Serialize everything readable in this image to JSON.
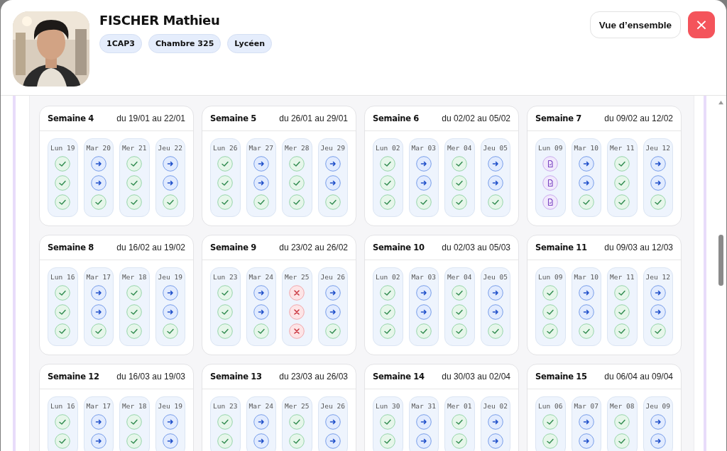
{
  "student": {
    "name": "FISCHER Mathieu",
    "tags": [
      "1CAP3",
      "Chambre 325",
      "Lycéen"
    ]
  },
  "buttons": {
    "overview": "Vue d’ensemble",
    "close": "×"
  },
  "weeks": [
    {
      "title": "Semaine 4",
      "range": "du 19/01 au 22/01",
      "days": [
        {
          "label": "Lun 19",
          "marks": [
            {
              "kind": "present"
            },
            {
              "kind": "present"
            },
            {
              "kind": "present"
            }
          ]
        },
        {
          "label": "Mar 20",
          "marks": [
            {
              "kind": "transfer"
            },
            {
              "kind": "transfer"
            },
            {
              "kind": "present"
            }
          ]
        },
        {
          "label": "Mer 21",
          "marks": [
            {
              "kind": "present"
            },
            {
              "kind": "present"
            },
            {
              "kind": "present"
            }
          ]
        },
        {
          "label": "Jeu 22",
          "marks": [
            {
              "kind": "transfer"
            },
            {
              "kind": "transfer"
            },
            {
              "kind": "present"
            }
          ]
        }
      ]
    },
    {
      "title": "Semaine 5",
      "range": "du 26/01 au 29/01",
      "days": [
        {
          "label": "Lun 26",
          "marks": [
            {
              "kind": "present"
            },
            {
              "kind": "present"
            },
            {
              "kind": "present"
            }
          ]
        },
        {
          "label": "Mar 27",
          "marks": [
            {
              "kind": "transfer"
            },
            {
              "kind": "transfer"
            },
            {
              "kind": "present"
            }
          ]
        },
        {
          "label": "Mer 28",
          "marks": [
            {
              "kind": "present"
            },
            {
              "kind": "present"
            },
            {
              "kind": "present"
            }
          ]
        },
        {
          "label": "Jeu 29",
          "marks": [
            {
              "kind": "transfer"
            },
            {
              "kind": "transfer"
            },
            {
              "kind": "present"
            }
          ]
        }
      ]
    },
    {
      "title": "Semaine 6",
      "range": "du 02/02 au 05/02",
      "days": [
        {
          "label": "Lun 02",
          "marks": [
            {
              "kind": "present"
            },
            {
              "kind": "present"
            },
            {
              "kind": "present"
            }
          ]
        },
        {
          "label": "Mar 03",
          "marks": [
            {
              "kind": "transfer"
            },
            {
              "kind": "transfer"
            },
            {
              "kind": "present"
            }
          ]
        },
        {
          "label": "Mer 04",
          "marks": [
            {
              "kind": "present"
            },
            {
              "kind": "present"
            },
            {
              "kind": "present"
            }
          ]
        },
        {
          "label": "Jeu 05",
          "marks": [
            {
              "kind": "transfer"
            },
            {
              "kind": "transfer"
            },
            {
              "kind": "present"
            }
          ]
        }
      ]
    },
    {
      "title": "Semaine 7",
      "range": "du 09/02 au 12/02",
      "days": [
        {
          "label": "Lun 09",
          "marks": [
            {
              "kind": "document"
            },
            {
              "kind": "document"
            },
            {
              "kind": "document"
            }
          ]
        },
        {
          "label": "Mar 10",
          "marks": [
            {
              "kind": "transfer"
            },
            {
              "kind": "transfer"
            },
            {
              "kind": "present"
            }
          ]
        },
        {
          "label": "Mer 11",
          "marks": [
            {
              "kind": "present"
            },
            {
              "kind": "present"
            },
            {
              "kind": "present"
            }
          ]
        },
        {
          "label": "Jeu 12",
          "marks": [
            {
              "kind": "transfer"
            },
            {
              "kind": "transfer"
            },
            {
              "kind": "present"
            }
          ]
        }
      ]
    },
    {
      "title": "Semaine 8",
      "range": "du 16/02 au 19/02",
      "days": [
        {
          "label": "Lun 16",
          "marks": [
            {
              "kind": "present"
            },
            {
              "kind": "present"
            },
            {
              "kind": "present"
            }
          ]
        },
        {
          "label": "Mar 17",
          "marks": [
            {
              "kind": "transfer"
            },
            {
              "kind": "transfer"
            },
            {
              "kind": "present"
            }
          ]
        },
        {
          "label": "Mer 18",
          "marks": [
            {
              "kind": "present"
            },
            {
              "kind": "present"
            },
            {
              "kind": "present"
            }
          ]
        },
        {
          "label": "Jeu 19",
          "marks": [
            {
              "kind": "transfer"
            },
            {
              "kind": "transfer"
            },
            {
              "kind": "present"
            }
          ]
        }
      ]
    },
    {
      "title": "Semaine 9",
      "range": "du 23/02 au 26/02",
      "days": [
        {
          "label": "Lun 23",
          "marks": [
            {
              "kind": "present"
            },
            {
              "kind": "present"
            },
            {
              "kind": "present"
            }
          ]
        },
        {
          "label": "Mar 24",
          "marks": [
            {
              "kind": "transfer"
            },
            {
              "kind": "transfer"
            },
            {
              "kind": "present"
            }
          ]
        },
        {
          "label": "Mer 25",
          "marks": [
            {
              "kind": "absent"
            },
            {
              "kind": "absent"
            },
            {
              "kind": "absent"
            }
          ]
        },
        {
          "label": "Jeu 26",
          "marks": [
            {
              "kind": "transfer"
            },
            {
              "kind": "transfer"
            },
            {
              "kind": "present"
            }
          ]
        }
      ]
    },
    {
      "title": "Semaine 10",
      "range": "du 02/03 au 05/03",
      "days": [
        {
          "label": "Lun 02",
          "marks": [
            {
              "kind": "present"
            },
            {
              "kind": "present"
            },
            {
              "kind": "present"
            }
          ]
        },
        {
          "label": "Mar 03",
          "marks": [
            {
              "kind": "transfer"
            },
            {
              "kind": "transfer"
            },
            {
              "kind": "present"
            }
          ]
        },
        {
          "label": "Mer 04",
          "marks": [
            {
              "kind": "present"
            },
            {
              "kind": "present"
            },
            {
              "kind": "present"
            }
          ]
        },
        {
          "label": "Jeu 05",
          "marks": [
            {
              "kind": "transfer"
            },
            {
              "kind": "transfer"
            },
            {
              "kind": "present"
            }
          ]
        }
      ]
    },
    {
      "title": "Semaine 11",
      "range": "du 09/03 au 12/03",
      "days": [
        {
          "label": "Lun 09",
          "marks": [
            {
              "kind": "present"
            },
            {
              "kind": "present"
            },
            {
              "kind": "present"
            }
          ]
        },
        {
          "label": "Mar 10",
          "marks": [
            {
              "kind": "transfer"
            },
            {
              "kind": "transfer"
            },
            {
              "kind": "present"
            }
          ]
        },
        {
          "label": "Mer 11",
          "marks": [
            {
              "kind": "present"
            },
            {
              "kind": "present"
            },
            {
              "kind": "present"
            }
          ]
        },
        {
          "label": "Jeu 12",
          "marks": [
            {
              "kind": "transfer"
            },
            {
              "kind": "transfer"
            },
            {
              "kind": "present"
            }
          ]
        }
      ]
    },
    {
      "title": "Semaine 12",
      "range": "du 16/03 au 19/03",
      "days": [
        {
          "label": "Lun 16",
          "marks": [
            {
              "kind": "present"
            },
            {
              "kind": "present"
            }
          ]
        },
        {
          "label": "Mar 17",
          "marks": [
            {
              "kind": "transfer"
            },
            {
              "kind": "transfer"
            }
          ]
        },
        {
          "label": "Mer 18",
          "marks": [
            {
              "kind": "present"
            },
            {
              "kind": "present"
            }
          ]
        },
        {
          "label": "Jeu 19",
          "marks": [
            {
              "kind": "transfer"
            },
            {
              "kind": "transfer"
            }
          ]
        }
      ]
    },
    {
      "title": "Semaine 13",
      "range": "du 23/03 au 26/03",
      "days": [
        {
          "label": "Lun 23",
          "marks": [
            {
              "kind": "present"
            },
            {
              "kind": "present"
            }
          ]
        },
        {
          "label": "Mar 24",
          "marks": [
            {
              "kind": "transfer"
            },
            {
              "kind": "transfer"
            }
          ]
        },
        {
          "label": "Mer 25",
          "marks": [
            {
              "kind": "present"
            },
            {
              "kind": "present"
            }
          ]
        },
        {
          "label": "Jeu 26",
          "marks": [
            {
              "kind": "transfer"
            },
            {
              "kind": "transfer"
            }
          ]
        }
      ]
    },
    {
      "title": "Semaine 14",
      "range": "du 30/03 au 02/04",
      "days": [
        {
          "label": "Lun 30",
          "marks": [
            {
              "kind": "present"
            },
            {
              "kind": "present"
            }
          ]
        },
        {
          "label": "Mar 31",
          "marks": [
            {
              "kind": "transfer"
            },
            {
              "kind": "transfer"
            }
          ]
        },
        {
          "label": "Mer 01",
          "marks": [
            {
              "kind": "present"
            },
            {
              "kind": "present"
            }
          ]
        },
        {
          "label": "Jeu 02",
          "marks": [
            {
              "kind": "transfer"
            },
            {
              "kind": "transfer"
            }
          ]
        }
      ]
    },
    {
      "title": "Semaine 15",
      "range": "du 06/04 au 09/04",
      "days": [
        {
          "label": "Lun 06",
          "marks": [
            {
              "kind": "present"
            },
            {
              "kind": "present"
            }
          ]
        },
        {
          "label": "Mar 07",
          "marks": [
            {
              "kind": "transfer"
            },
            {
              "kind": "transfer"
            }
          ]
        },
        {
          "label": "Mer 08",
          "marks": [
            {
              "kind": "present"
            },
            {
              "kind": "present"
            }
          ]
        },
        {
          "label": "Jeu 09",
          "marks": [
            {
              "kind": "transfer"
            },
            {
              "kind": "transfer"
            }
          ]
        }
      ]
    }
  ]
}
